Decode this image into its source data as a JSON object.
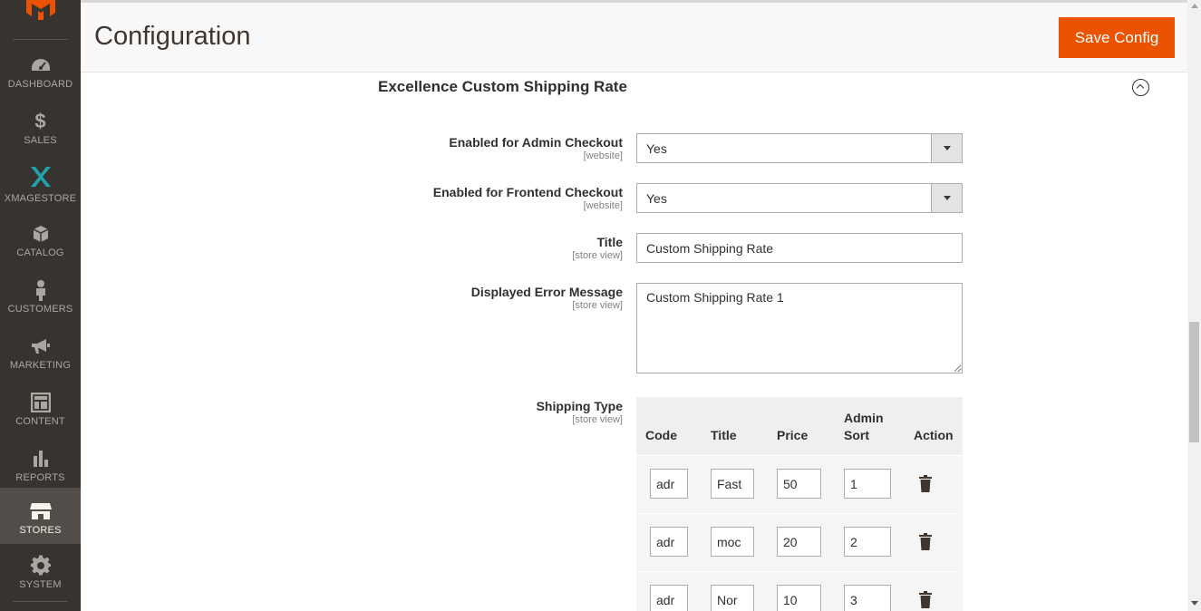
{
  "sidebar": {
    "items": [
      {
        "label": "DASHBOARD",
        "icon": "dashboard-icon"
      },
      {
        "label": "SALES",
        "icon": "dollar-icon"
      },
      {
        "label": "XMAGESTORE",
        "icon": "xmagestore-icon"
      },
      {
        "label": "CATALOG",
        "icon": "cube-icon"
      },
      {
        "label": "CUSTOMERS",
        "icon": "person-icon"
      },
      {
        "label": "MARKETING",
        "icon": "megaphone-icon"
      },
      {
        "label": "CONTENT",
        "icon": "layout-icon"
      },
      {
        "label": "REPORTS",
        "icon": "bar-chart-icon"
      },
      {
        "label": "STORES",
        "icon": "store-icon"
      },
      {
        "label": "SYSTEM",
        "icon": "gear-icon"
      }
    ],
    "active": "STORES"
  },
  "header": {
    "title": "Configuration",
    "save_label": "Save Config"
  },
  "section": {
    "title": "Excellence Custom Shipping Rate"
  },
  "fields": {
    "admin_checkout": {
      "label": "Enabled for Admin Checkout",
      "scope": "[website]",
      "value": "Yes"
    },
    "frontend_checkout": {
      "label": "Enabled for Frontend Checkout",
      "scope": "[website]",
      "value": "Yes"
    },
    "title": {
      "label": "Title",
      "scope": "[store view]",
      "value": "Custom Shipping Rate"
    },
    "error_message": {
      "label": "Displayed Error Message",
      "scope": "[store view]",
      "value": "Custom Shipping Rate 1"
    },
    "shipping_type": {
      "label": "Shipping Type",
      "scope": "[store view]"
    }
  },
  "shipping_grid": {
    "headers": {
      "code": "Code",
      "title": "Title",
      "price": "Price",
      "admin_sort_1": "Admin",
      "admin_sort_2": "Sort",
      "action": "Action"
    },
    "rows": [
      {
        "code": "adr",
        "title": "Fast",
        "price": "50",
        "sort": "1"
      },
      {
        "code": "adr",
        "title": "moc",
        "price": "20",
        "sort": "2"
      },
      {
        "code": "adr",
        "title": "Nor",
        "price": "10",
        "sort": "3"
      }
    ]
  },
  "colors": {
    "sidebar_bg": "#373330",
    "active_bg": "#524d49",
    "accent": "#eb5202"
  }
}
